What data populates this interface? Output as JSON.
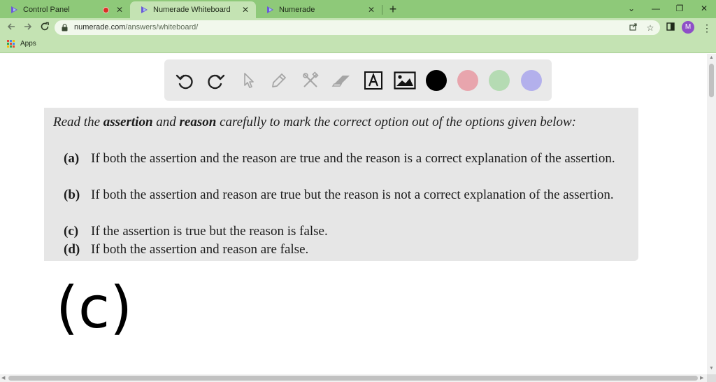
{
  "tabs": [
    {
      "title": "Control Panel",
      "recording": true
    },
    {
      "title": "Numerade Whiteboard",
      "active": true
    },
    {
      "title": "Numerade"
    }
  ],
  "new_tab_label": "+",
  "window_controls": {
    "minimize": "⌄",
    "min": "—",
    "restore": "❐",
    "close": "✕"
  },
  "address": {
    "host": "numerade.com",
    "path": "/answers/whiteboard/"
  },
  "profile_initial": "M",
  "bookmarks": {
    "apps_label": "Apps"
  },
  "colors": {
    "tab_strip": "#8ec979",
    "toolbar": "#c4e3b3",
    "favicon": "#6b5bd6",
    "swatch_black": "#000000",
    "swatch_pink": "#e8a5ad",
    "swatch_green": "#b5dbb3",
    "swatch_purple": "#b3b0ec"
  },
  "whiteboard_tools": [
    "undo-icon",
    "redo-icon",
    "pointer-icon",
    "pen-icon",
    "tools-icon",
    "eraser-icon",
    "text-icon",
    "image-icon"
  ],
  "question": {
    "intro_pre": "Read the ",
    "intro_b1": "assertion",
    "intro_mid": " and ",
    "intro_b2": "reason",
    "intro_post": " carefully to mark the correct option out of the options given below:",
    "options": [
      {
        "label": "(a)",
        "text": "If both the assertion and the reason are true and the reason is a correct explanation of the assertion."
      },
      {
        "label": "(b)",
        "text": "If both the assertion and reason are true but the reason is not a correct explanation of the assertion."
      },
      {
        "label": "(c)",
        "text": "If the assertion is true but the reason is false."
      },
      {
        "label": "(d)",
        "text": "If both the assertion and reason are false."
      }
    ]
  },
  "answer": "(c)"
}
